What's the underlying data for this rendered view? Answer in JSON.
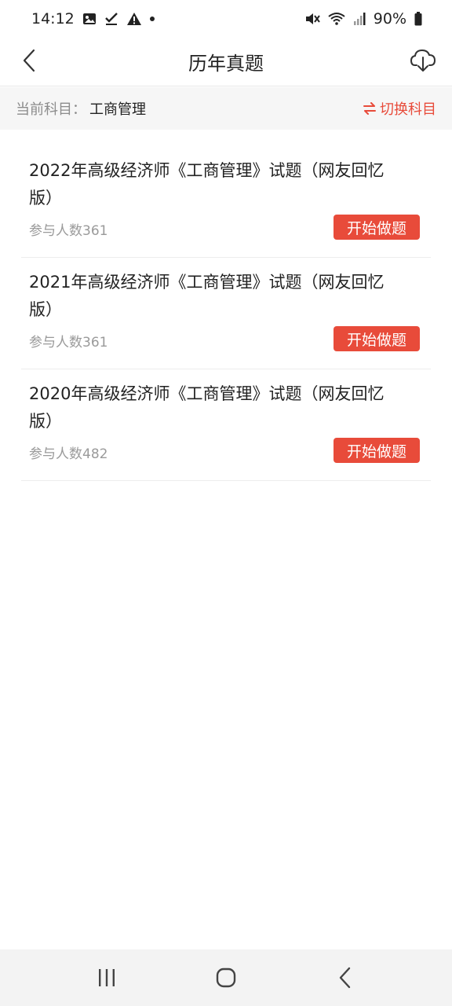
{
  "status_bar": {
    "time": "14:12",
    "battery": "90%"
  },
  "header": {
    "title": "历年真题"
  },
  "subject": {
    "prefix": "当前科目：",
    "name": "工商管理",
    "switch_label": "切换科目"
  },
  "exams": [
    {
      "title": "2022年高级经济师《工商管理》试题（网友回忆版）",
      "participants": "参与人数361",
      "button": "开始做题"
    },
    {
      "title": "2021年高级经济师《工商管理》试题（网友回忆版）",
      "participants": "参与人数361",
      "button": "开始做题"
    },
    {
      "title": "2020年高级经济师《工商管理》试题（网友回忆版）",
      "participants": "参与人数482",
      "button": "开始做题"
    }
  ],
  "colors": {
    "accent": "#e84b3a",
    "muted_text": "#9a9a9a",
    "subject_bar_bg": "#f6f6f6"
  }
}
